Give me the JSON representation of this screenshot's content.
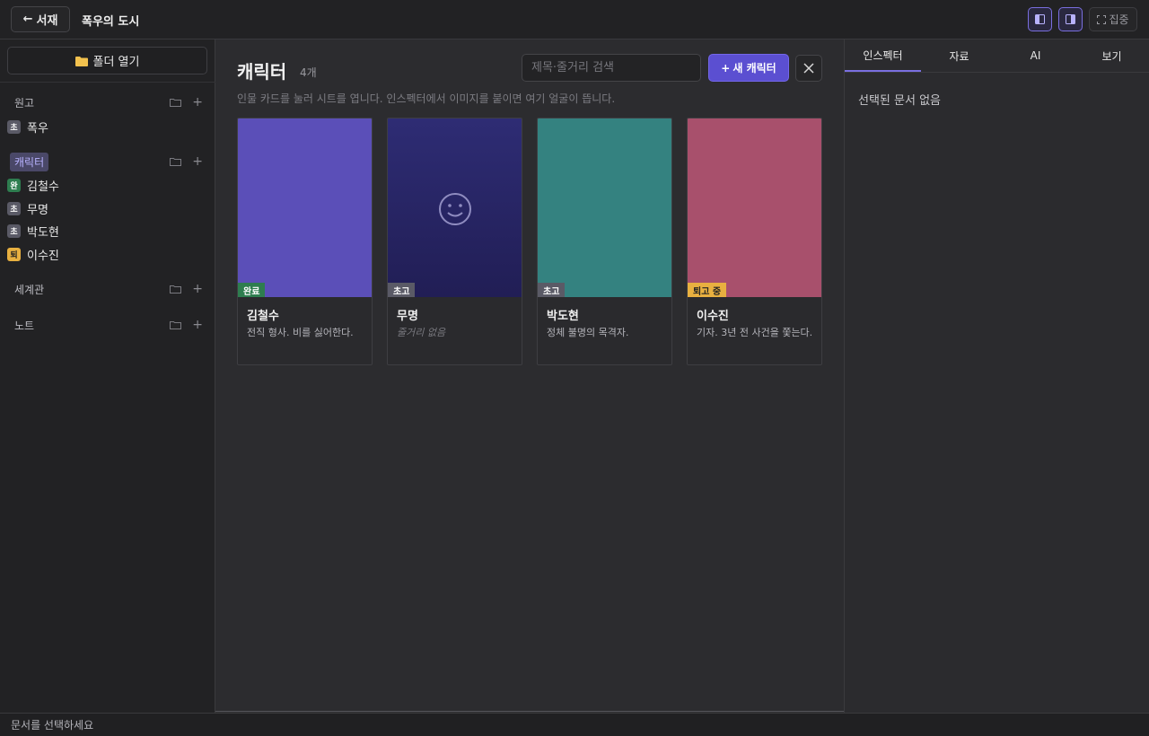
{
  "topbar": {
    "back_arrow": "←",
    "back_label": "서재",
    "doc_title": "폭우의 도시",
    "focus_label": "집중"
  },
  "sidebar": {
    "open_folder_label": "폴더 열기",
    "sections": {
      "manuscript": {
        "label": "원고",
        "items": [
          {
            "status": "초",
            "label": "폭우"
          }
        ]
      },
      "characters": {
        "label": "캐릭터",
        "items": [
          {
            "status": "완",
            "label": "김철수"
          },
          {
            "status": "초",
            "label": "무명"
          },
          {
            "status": "초",
            "label": "박도현"
          },
          {
            "status": "퇴",
            "label": "이수진"
          }
        ]
      },
      "world": {
        "label": "세계관"
      },
      "notes": {
        "label": "노트"
      }
    }
  },
  "main": {
    "title": "캐릭터",
    "count": "4개",
    "search_placeholder": "제목·줄거리 검색",
    "new_button_label": "새 캐릭터",
    "new_button_plus": "+",
    "hint": "인물 카드를 눌러 시트를 엽니다. 인스펙터에서 이미지를 붙이면 여기 얼굴이 뜹니다.",
    "cards": [
      {
        "name": "김철수",
        "badge": "완료",
        "desc": "전직 형사. 비를 싫어한다.",
        "color": "#5b4fb8",
        "badge_color": "#2e7d4f"
      },
      {
        "name": "무명",
        "badge": "초고",
        "desc": "줄거리 없음",
        "color": "#2a2866",
        "badge_color": "#5a5a66"
      },
      {
        "name": "박도현",
        "badge": "초고",
        "desc": "정체 불명의 목격자.",
        "color": "#348280",
        "badge_color": "#5a5a66"
      },
      {
        "name": "이수진",
        "badge": "퇴고 중",
        "desc": "기자. 3년 전 사건을 쫓는다.",
        "color": "#a8506c",
        "badge_color": "#e8b040"
      }
    ]
  },
  "inspector": {
    "tabs": [
      "인스펙터",
      "자료",
      "AI",
      "보기"
    ],
    "empty_message": "선택된 문서 없음"
  },
  "statusbar": {
    "message": "문서를 선택하세요"
  },
  "colors": {
    "accent": "#5b4fd1",
    "done": "#2e7d4f",
    "draft": "#5a5a66",
    "revising": "#e8b040"
  }
}
